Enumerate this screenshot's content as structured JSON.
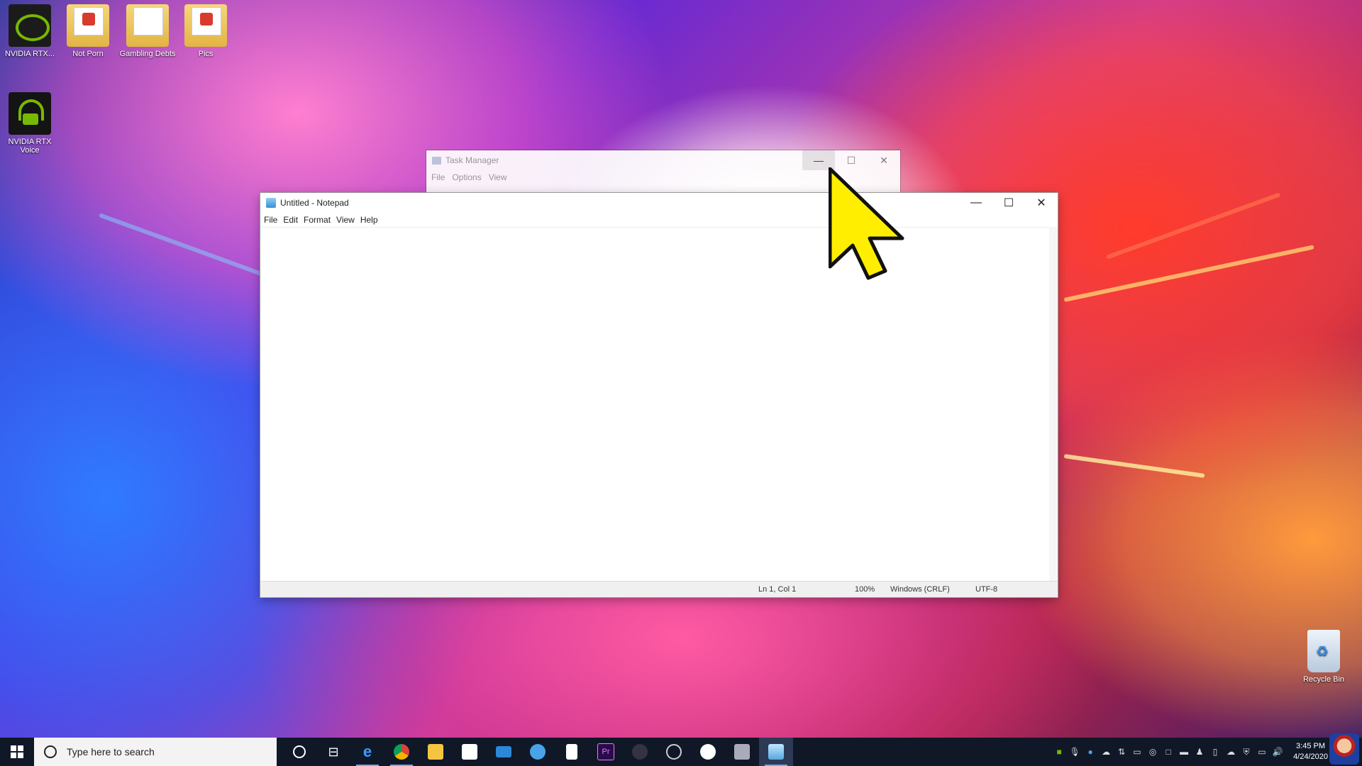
{
  "desktop": {
    "icons": [
      {
        "label": "NVIDIA RTX..."
      },
      {
        "label": "Not Porn"
      },
      {
        "label": "Gambling Debts"
      },
      {
        "label": "Pics"
      },
      {
        "label": "NVIDIA RTX Voice"
      }
    ],
    "recycle_bin": "Recycle Bin"
  },
  "task_manager": {
    "title": "Task Manager",
    "menu": [
      "File",
      "Options",
      "View"
    ]
  },
  "notepad": {
    "title": "Untitled - Notepad",
    "menu": [
      "File",
      "Edit",
      "Format",
      "View",
      "Help"
    ],
    "content": "",
    "status": {
      "position": "Ln 1, Col 1",
      "zoom": "100%",
      "line_ending": "Windows (CRLF)",
      "encoding": "UTF-8"
    }
  },
  "window_buttons": {
    "minimize": "—",
    "maximize": "☐",
    "close": "✕"
  },
  "taskbar": {
    "search_placeholder": "Type here to search",
    "apps": [
      "cortana",
      "task-view",
      "edge",
      "chrome",
      "file-explorer",
      "store",
      "mail",
      "steam",
      "notepad-file",
      "premiere-pro",
      "obs",
      "davinci",
      "origin",
      "explorer-window",
      "notepad"
    ],
    "clock_time": "3:45 PM",
    "clock_date": "4/24/2020"
  },
  "colors": {
    "nvidia_green": "#76b900",
    "taskbar": "#101828",
    "cursor": "#ffee00"
  }
}
